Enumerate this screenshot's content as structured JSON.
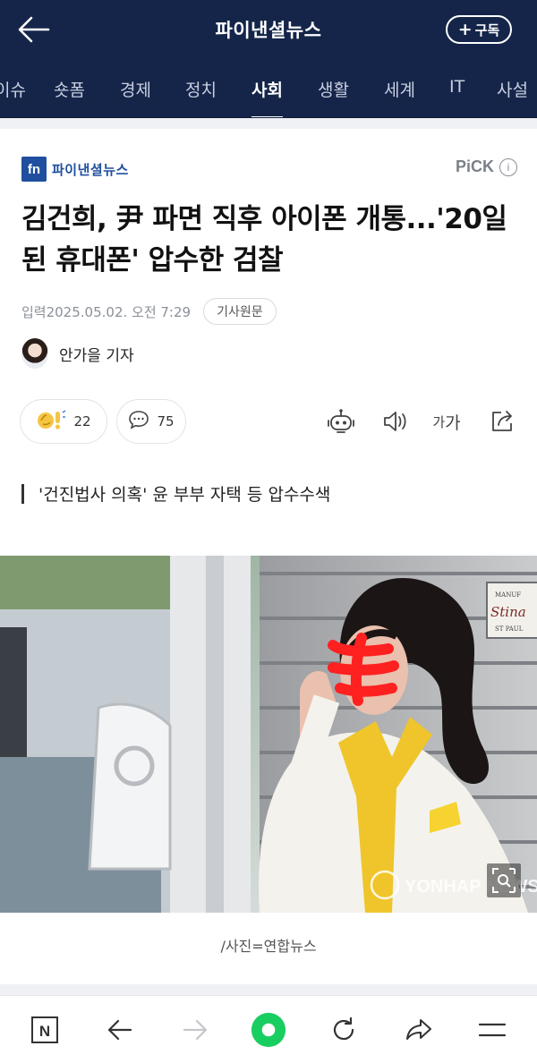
{
  "header": {
    "brand": "파이낸셜뉴스",
    "subscribe_label": "구독",
    "subscribe_plus": "+"
  },
  "tabs": [
    {
      "label": "이슈",
      "active": false
    },
    {
      "label": "숏폼",
      "active": false
    },
    {
      "label": "경제",
      "active": false
    },
    {
      "label": "정치",
      "active": false
    },
    {
      "label": "사회",
      "active": true
    },
    {
      "label": "생활",
      "active": false
    },
    {
      "label": "세계",
      "active": false
    },
    {
      "label": "IT",
      "active": false
    },
    {
      "label": "사설",
      "active": false
    }
  ],
  "article": {
    "logo_mark": "fn",
    "logo_text": "파이낸셜뉴스",
    "pick_label": "PiCK",
    "pick_info": "i",
    "headline": "김건희, 尹 파면 직후 아이폰 개통...'20일 된 휴대폰' 압수한 검찰",
    "date": "입력2025.05.02. 오전 7:29",
    "original_button": "기사원문",
    "author": "안가을 기자",
    "reactions_count": "22",
    "comments_count": "75",
    "font_size_small": "가",
    "font_size_big": "가",
    "subheading": "'건진법사 의혹' 윤 부부 자택 등 압수수색",
    "photo_watermark": "YONHAP NEWS",
    "photo_sign_top": "MANUF",
    "photo_sign_main": "Stina",
    "photo_sign_bottom": "ST PAUL",
    "caption": "/사진=연합뉴스"
  },
  "bottom_nav": {
    "naver_label": "N"
  },
  "colors": {
    "header_bg": "#15254a",
    "brand_blue": "#1f4f9e",
    "green_home": "#19ce60"
  }
}
